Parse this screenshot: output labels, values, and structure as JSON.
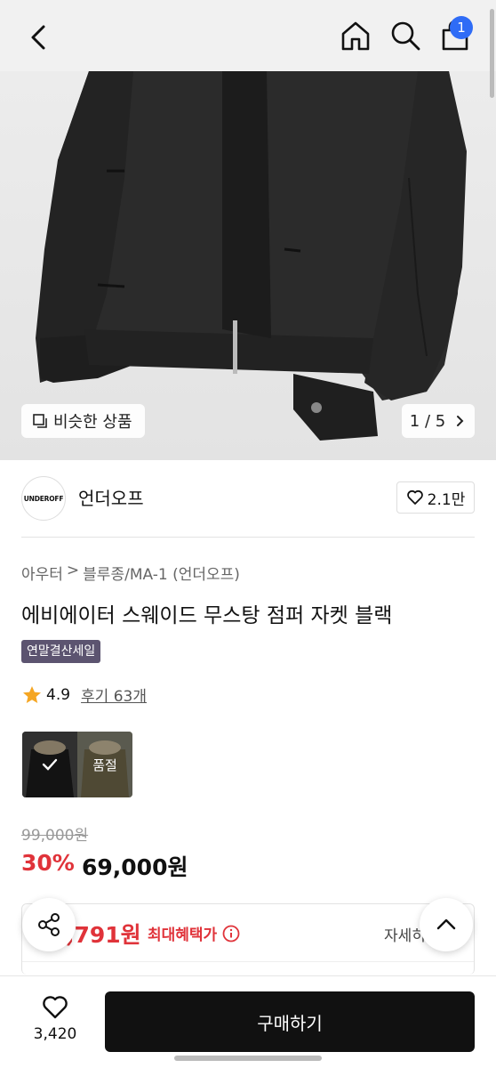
{
  "header": {
    "back_icon": "chevron-left-icon",
    "home_icon": "home-icon",
    "search_icon": "search-icon",
    "cart_icon": "cart-icon",
    "cart_count": "1",
    "badge_color": "#2f6cf6"
  },
  "gallery": {
    "similar_label": "비슷한 상품",
    "page_indicator": "1 / 5"
  },
  "brand": {
    "logo_text": "UNDEROFF",
    "name": "언더오프",
    "likes": "2.1만"
  },
  "product": {
    "breadcrumb": [
      "아우터",
      "블루종/MA-1 (언더오프)"
    ],
    "title": "에비에이터 스웨이드 무스탕 점퍼 자켓 블랙",
    "event_badge": "연말결산세일",
    "rating": "4.9",
    "reviews": "후기 63개",
    "variants": [
      {
        "selected": true,
        "label": ""
      },
      {
        "selected": false,
        "label": "품절"
      }
    ],
    "original_price": "99,000원",
    "discount": "30%",
    "sale_price": "69,000원"
  },
  "benefit": {
    "price": ",791원",
    "label": "최대혜택가",
    "detail": "자세히"
  },
  "bottom": {
    "wish_count": "3,420",
    "buy_label": "구매하기"
  },
  "colors": {
    "sale_red": "#e0333a",
    "buy_button": "#111111",
    "event_badge": "#5c5470"
  }
}
